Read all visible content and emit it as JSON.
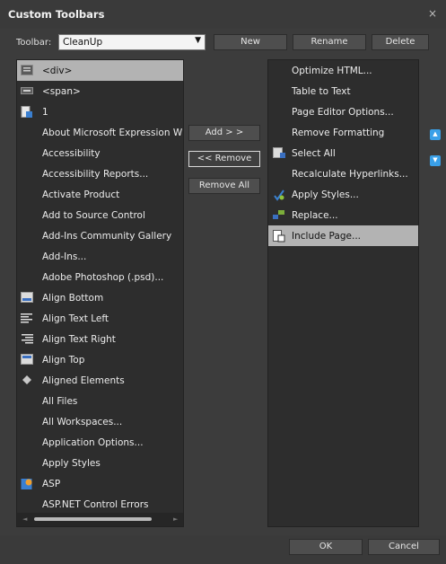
{
  "window": {
    "title": "Custom Toolbars",
    "close_glyph": "×"
  },
  "toolbar_selector": {
    "label": "Toolbar:",
    "value": "CleanUp",
    "arrow_glyph": "▼"
  },
  "top_buttons": {
    "new": "New",
    "rename": "Rename",
    "delete": "Delete"
  },
  "middle_buttons": {
    "add": "Add > >",
    "remove": "<< Remove",
    "remove_all": "Remove All"
  },
  "available_commands": [
    {
      "label": "<div>",
      "icon": "div-tag-icon",
      "selected": true
    },
    {
      "label": "<span>",
      "icon": "span-tag-icon"
    },
    {
      "label": "1",
      "icon": "page-icon"
    },
    {
      "label": "About Microsoft Expression W",
      "icon": ""
    },
    {
      "label": "Accessibility",
      "icon": ""
    },
    {
      "label": "Accessibility Reports...",
      "icon": ""
    },
    {
      "label": "Activate Product",
      "icon": ""
    },
    {
      "label": "Add to Source Control",
      "icon": ""
    },
    {
      "label": "Add-Ins Community Gallery",
      "icon": ""
    },
    {
      "label": "Add-Ins...",
      "icon": ""
    },
    {
      "label": "Adobe Photoshop (.psd)...",
      "icon": ""
    },
    {
      "label": "Align Bottom",
      "icon": "align-bottom-icon"
    },
    {
      "label": "Align Text Left",
      "icon": "align-text-left-icon"
    },
    {
      "label": "Align Text Right",
      "icon": "align-text-right-icon"
    },
    {
      "label": "Align Top",
      "icon": "align-top-icon"
    },
    {
      "label": "Aligned Elements",
      "icon": "aligned-elements-icon"
    },
    {
      "label": "All Files",
      "icon": ""
    },
    {
      "label": "All Workspaces...",
      "icon": ""
    },
    {
      "label": "Application Options...",
      "icon": ""
    },
    {
      "label": "Apply Styles",
      "icon": ""
    },
    {
      "label": "ASP",
      "icon": "asp-icon"
    },
    {
      "label": "ASP.NET Control Errors",
      "icon": ""
    }
  ],
  "toolbar_commands": [
    {
      "label": "Optimize HTML...",
      "icon": ""
    },
    {
      "label": "Table to Text",
      "icon": ""
    },
    {
      "label": "Page Editor Options...",
      "icon": ""
    },
    {
      "label": "Remove Formatting",
      "icon": ""
    },
    {
      "label": "Select All",
      "icon": "select-all-icon"
    },
    {
      "label": "Recalculate Hyperlinks...",
      "icon": ""
    },
    {
      "label": "Apply Styles...",
      "icon": "apply-styles-icon"
    },
    {
      "label": "Replace...",
      "icon": "replace-icon"
    },
    {
      "label": "Include Page...",
      "icon": "include-page-icon",
      "selected": true
    }
  ],
  "reorder": {
    "up_glyph": "▲",
    "down_glyph": "▼"
  },
  "scroll_glyphs": {
    "up": "▲",
    "down": "▼",
    "left": "◄",
    "right": "►"
  },
  "footer": {
    "ok": "OK",
    "cancel": "Cancel"
  },
  "colors": {
    "background": "#3c3c3c",
    "list_background": "#2d2d2d",
    "selection": "#b3b3b3",
    "accent": "#3aa0e8"
  }
}
